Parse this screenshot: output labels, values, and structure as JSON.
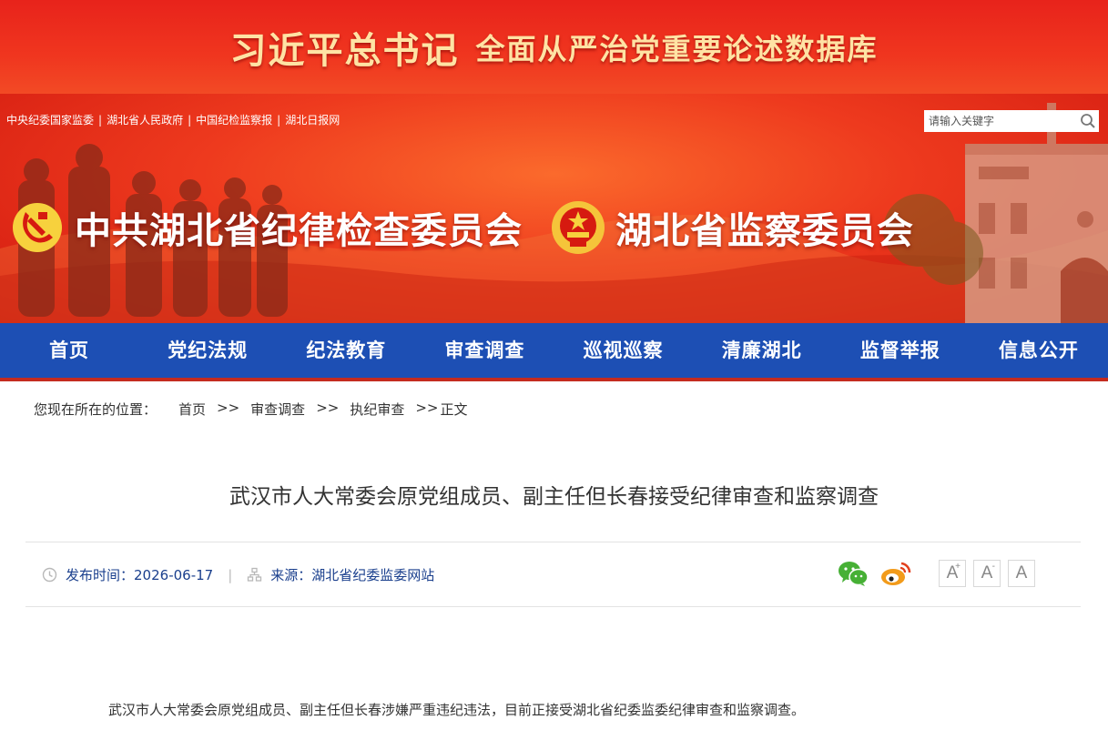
{
  "top_banner": {
    "part1": "习近平总书记",
    "part2": "全面从严治党重要论述数据库"
  },
  "header": {
    "util_links": [
      "中央纪委国家监委",
      "湖北省人民政府",
      "中国纪检监察报",
      "湖北日报网"
    ],
    "search_placeholder": "请输入关键字",
    "title_left": "中共湖北省纪律检查委员会",
    "title_right": "湖北省监察委员会"
  },
  "nav": {
    "items": [
      "首页",
      "党纪法规",
      "纪法教育",
      "审查调查",
      "巡视巡察",
      "清廉湖北",
      "监督举报",
      "信息公开"
    ]
  },
  "breadcrumb": {
    "label": "您现在所在的位置：",
    "items": [
      "首页",
      "审查调查",
      "执纪审查",
      "正文"
    ],
    "separator": ">>"
  },
  "article": {
    "title": "武汉市人大常委会原党组成员、副主任但长春接受纪律审查和监察调查",
    "publish_label": "发布时间：",
    "publish_date": "2026-06-17",
    "source_label": "来源：",
    "source": "湖北省纪委监委网站",
    "meta_separator": "|",
    "font_buttons": [
      "A",
      "A",
      "A"
    ],
    "font_button_marks": [
      "+",
      "-"
    ],
    "body": "武汉市人大常委会原党组成员、副主任但长春涉嫌严重违纪违法，目前正接受湖北省纪委监委纪律审查和监察调查。"
  },
  "colors": {
    "banner_red": "#e8231b",
    "banner_text": "#ffe3a4",
    "nav_blue": "#1d4fb4",
    "nav_border": "#c42b1f",
    "meta_blue": "#1a3f8d",
    "wechat_green": "#46b035",
    "weibo_orange": "#f29b1b"
  },
  "icons": [
    "search-icon",
    "party-emblem-icon",
    "national-emblem-icon",
    "clock-icon",
    "source-icon",
    "wechat-icon",
    "weibo-icon"
  ]
}
